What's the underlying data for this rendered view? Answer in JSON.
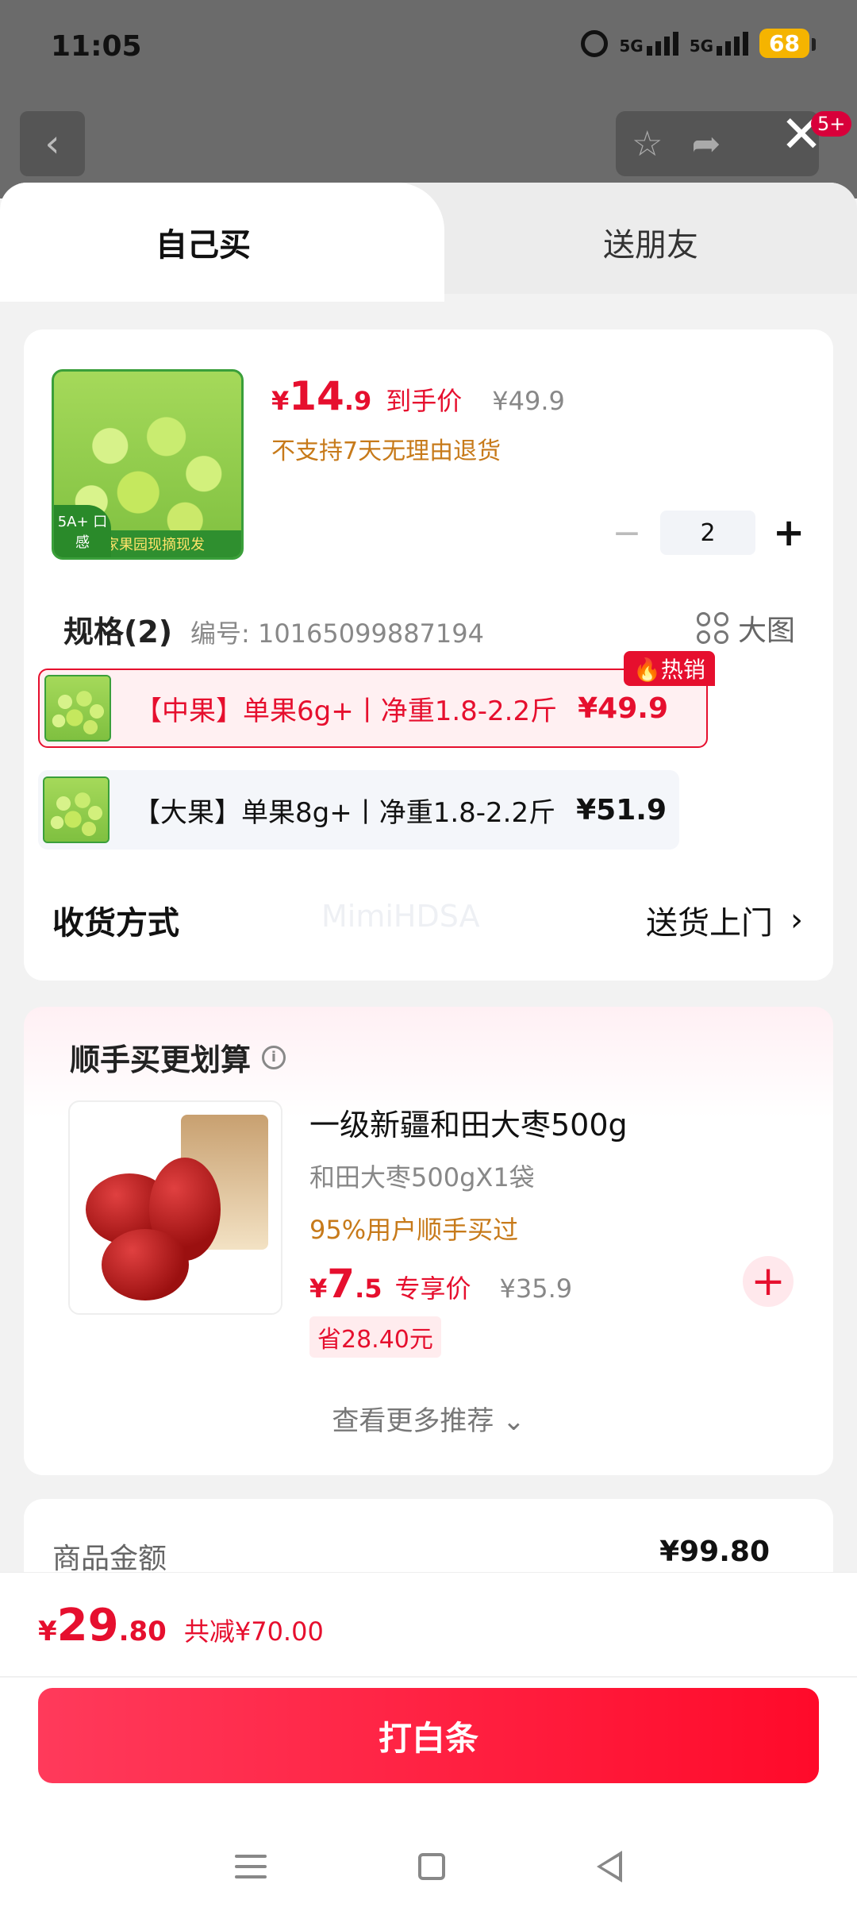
{
  "status_bar": {
    "time": "11:05",
    "battery": "68",
    "net1": "5G",
    "net2": "5G"
  },
  "background_page": {
    "badge": "5+"
  },
  "tabs": [
    {
      "label": "自己买"
    },
    {
      "label": "送朋友"
    }
  ],
  "product": {
    "price_currency": "¥",
    "price_int": "14",
    "price_dec": ".9",
    "price_label": "到手价",
    "original_price": "¥49.9",
    "return_policy": "不支持7天无理由退货",
    "quantity": "2",
    "thumb_banner": "自家果园现摘现发",
    "thumb_tag": "5A+ 口感"
  },
  "spec": {
    "title": "规格(2)",
    "code": "编号: 10165099887194",
    "big_image_label": "大图",
    "hot_badge": "热销",
    "options": [
      {
        "text": "【中果】单果6g+丨净重1.8-2.2斤",
        "price": "¥49.9"
      },
      {
        "text": "【大果】单果8g+丨净重1.8-2.2斤",
        "price": "¥51.9"
      }
    ]
  },
  "delivery": {
    "label": "收货方式",
    "value": "送货上门",
    "arrow": "›"
  },
  "watermark": "MimiHDSA",
  "recommend": {
    "title": "顺手买更划算",
    "name": "一级新疆和田大枣500g",
    "spec": "和田大枣500gX1袋",
    "bought": "95%用户顺手买过",
    "price_currency": "¥",
    "price_int": "7",
    "price_dec": ".5",
    "price_label": "专享价",
    "original_price": "¥35.9",
    "save": "省28.40元",
    "more": "查看更多推荐 ⌄"
  },
  "summary": {
    "amount_label": "商品金额",
    "amount_value": "¥99.80"
  },
  "bottom": {
    "currency": "¥",
    "total_int": "29",
    "total_dec": ".80",
    "discount": "共减¥70.00",
    "pay_button": "打白条"
  },
  "colors": {
    "accent": "#e60f2e",
    "orange": "#c77a1a"
  }
}
